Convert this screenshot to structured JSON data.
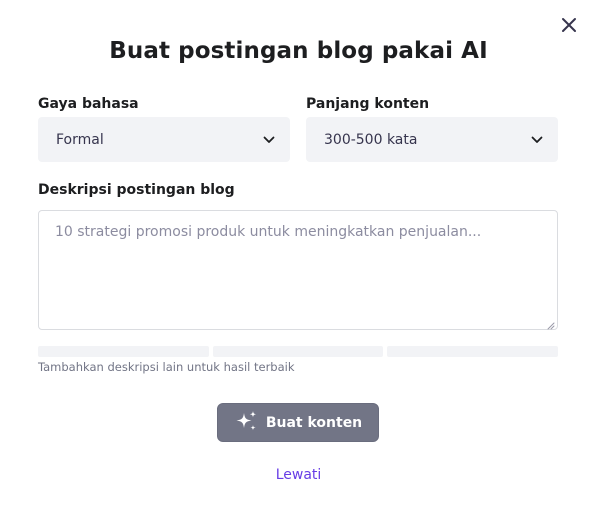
{
  "dialog": {
    "title": "Buat postingan blog pakai AI",
    "close_icon": "close-icon"
  },
  "form": {
    "style": {
      "label": "Gaya bahasa",
      "value": "Formal"
    },
    "length": {
      "label": "Panjang konten",
      "value": "300-500 kata"
    },
    "description": {
      "label": "Deskripsi postingan blog",
      "placeholder": "10 strategi promosi produk untuk meningkatkan penjualan..."
    },
    "quality_segments": 3,
    "hint": "Tambahkan deskripsi lain untuk hasil terbaik"
  },
  "actions": {
    "submit_label": "Buat konten",
    "submit_icon": "sparkle-icon",
    "skip_label": "Lewati"
  },
  "colors": {
    "accent": "#673de6",
    "button_disabled": "#727586",
    "field_bg": "#f2f3f6",
    "heading": "#1d1e20"
  }
}
